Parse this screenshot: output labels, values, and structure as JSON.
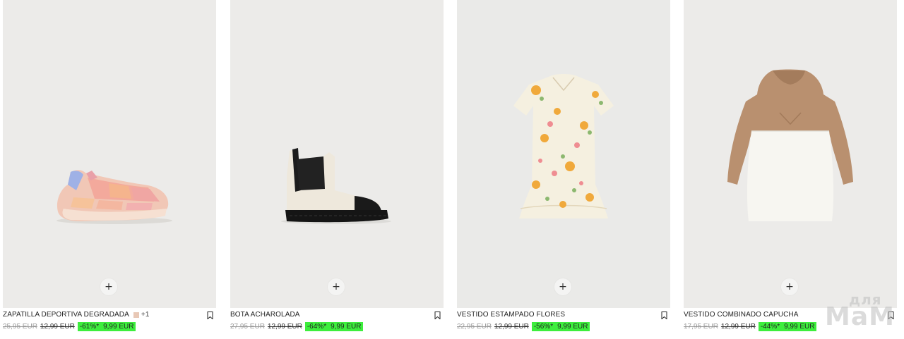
{
  "products": [
    {
      "name": "ZAPATILLA DEPORTIVA DEGRADADA",
      "more_colors": "+1",
      "swatch_color": "#e8c8b6",
      "original_price": "25,95 EUR",
      "previous_price": "12,99 EUR",
      "discount": "-61%*",
      "sale_price": "9,99 EUR",
      "quick_add": "+",
      "image_icon": "sneaker-icon"
    },
    {
      "name": "BOTA ACHAROLADA",
      "original_price": "27,95 EUR",
      "previous_price": "12,99 EUR",
      "discount": "-64%*",
      "sale_price": "9,99 EUR",
      "quick_add": "+",
      "image_icon": "boot-icon"
    },
    {
      "name": "VESTIDO ESTAMPADO FLORES",
      "original_price": "22,95 EUR",
      "previous_price": "12,99 EUR",
      "discount": "-56%*",
      "sale_price": "9,99 EUR",
      "quick_add": "+",
      "image_icon": "floral-dress-icon"
    },
    {
      "name": "VESTIDO COMBINADO CAPUCHA",
      "original_price": "17,95 EUR",
      "previous_price": "12,99 EUR",
      "discount": "-44%*",
      "sale_price": "9,99 EUR",
      "quick_add": "+",
      "image_icon": "hooded-dress-icon"
    }
  ],
  "watermark": {
    "top": "для",
    "bottom": "МаМ"
  },
  "colors": {
    "discount_highlight": "#3dee3d",
    "image_background": "#ecebe9"
  }
}
